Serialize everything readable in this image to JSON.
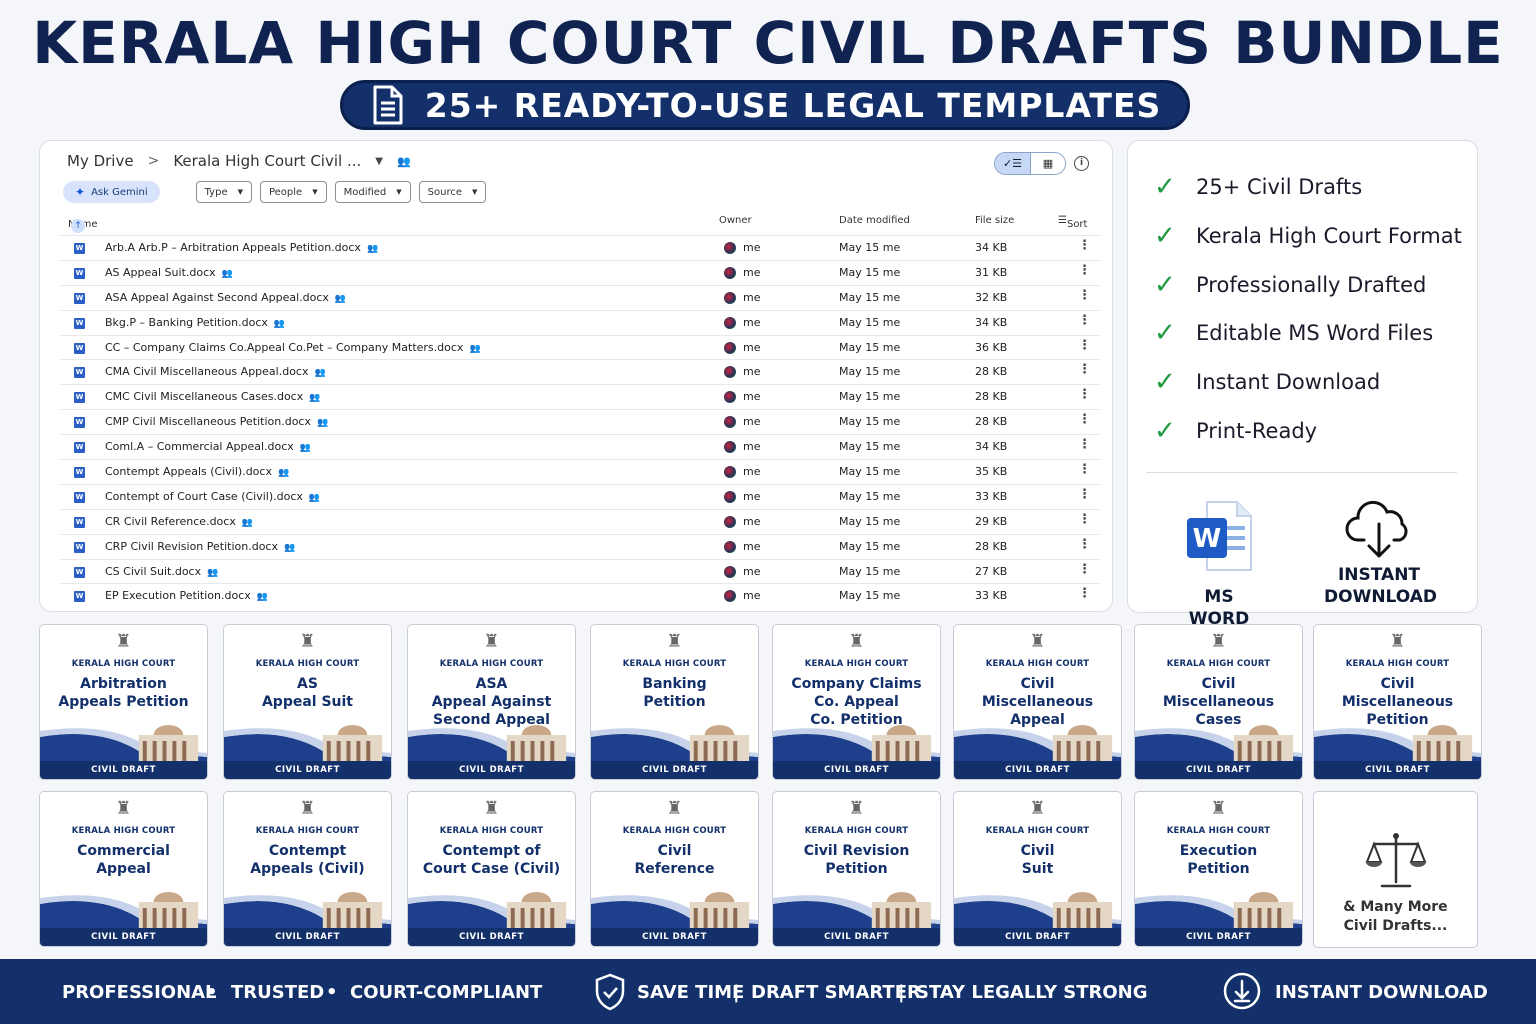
{
  "title": "KERALA HIGH COURT CIVIL DRAFTS BUNDLE",
  "subtitle": "25+ READY-TO-USE LEGAL TEMPLATES",
  "drive": {
    "crumb_root": "My Drive",
    "crumb_sep": ">",
    "crumb_current": "Kerala High Court Civil ...",
    "ask_gemini": "Ask Gemini",
    "filters": [
      "Type",
      "People",
      "Modified",
      "Source"
    ],
    "columns": {
      "name": "Name",
      "owner": "Owner",
      "date": "Date modified",
      "size": "File size",
      "sort": "Sort"
    },
    "files": [
      {
        "name": "Arb.A  Arb.P – Arbitration Appeals  Petition.docx",
        "owner": "me",
        "date": "May 15 me",
        "size": "34 KB"
      },
      {
        "name": "AS Appeal Suit.docx",
        "owner": "me",
        "date": "May 15 me",
        "size": "31 KB"
      },
      {
        "name": "ASA Appeal Against Second Appeal.docx",
        "owner": "me",
        "date": "May 15 me",
        "size": "32 KB"
      },
      {
        "name": "Bkg.P – Banking Petition.docx",
        "owner": "me",
        "date": "May 15 me",
        "size": "34 KB"
      },
      {
        "name": "CC – Company Claims  Co.Appeal  Co.Pet – Company Matters.docx",
        "owner": "me",
        "date": "May 15 me",
        "size": "36 KB"
      },
      {
        "name": "CMA Civil Miscellaneous Appeal.docx",
        "owner": "me",
        "date": "May 15 me",
        "size": "28 KB"
      },
      {
        "name": "CMC Civil Miscellaneous Cases.docx",
        "owner": "me",
        "date": "May 15 me",
        "size": "28 KB"
      },
      {
        "name": "CMP Civil Miscellaneous Petition.docx",
        "owner": "me",
        "date": "May 15 me",
        "size": "28 KB"
      },
      {
        "name": "Coml.A – Commercial Appeal.docx",
        "owner": "me",
        "date": "May 15 me",
        "size": "34 KB"
      },
      {
        "name": "Contempt Appeals (Civil).docx",
        "owner": "me",
        "date": "May 15 me",
        "size": "35 KB"
      },
      {
        "name": "Contempt of Court Case (Civil).docx",
        "owner": "me",
        "date": "May 15 me",
        "size": "33 KB"
      },
      {
        "name": "CR Civil Reference.docx",
        "owner": "me",
        "date": "May 15 me",
        "size": "29 KB"
      },
      {
        "name": "CRP Civil Revision Petition.docx",
        "owner": "me",
        "date": "May 15 me",
        "size": "28 KB"
      },
      {
        "name": "CS Civil Suit.docx",
        "owner": "me",
        "date": "May 15 me",
        "size": "27 KB"
      },
      {
        "name": "EP Execution Petition.docx",
        "owner": "me",
        "date": "May 15 me",
        "size": "33 KB"
      }
    ]
  },
  "features": {
    "items": [
      "25+ Civil Drafts",
      "Kerala High Court Format",
      "Professionally Drafted",
      "Editable MS Word Files",
      "Instant Download",
      "Print-Ready"
    ],
    "msword_label": "MS WORD",
    "download_label_1": "INSTANT",
    "download_label_2": "DOWNLOAD"
  },
  "cards": {
    "court": "KERALA HIGH COURT",
    "tag": "CIVIL DRAFT",
    "items": [
      [
        "Arbitration",
        "Appeals Petition"
      ],
      [
        "AS",
        "Appeal Suit"
      ],
      [
        "ASA",
        "Appeal Against",
        "Second Appeal"
      ],
      [
        "Banking",
        "Petition"
      ],
      [
        "Company Claims",
        "Co. Appeal",
        "Co. Petition"
      ],
      [
        "Civil",
        "Miscellaneous",
        "Appeal"
      ],
      [
        "Civil",
        "Miscellaneous",
        "Cases"
      ],
      [
        "Civil",
        "Miscellaneous",
        "Petition"
      ],
      [
        "Commercial",
        "Appeal"
      ],
      [
        "Contempt",
        "Appeals (Civil)"
      ],
      [
        "Contempt of",
        "Court Case (Civil)"
      ],
      [
        "Civil",
        "Reference"
      ],
      [
        "Civil Revision",
        "Petition"
      ],
      [
        "Civil",
        "Suit"
      ],
      [
        "Execution",
        "Petition"
      ]
    ],
    "more_1": "& Many More",
    "more_2": "Civil Drafts..."
  },
  "footer": {
    "professional": "PROFESSIONAL",
    "trusted": "TRUSTED",
    "compliant": "COURT-COMPLIANT",
    "bullet": "•",
    "save_time": "SAVE TIME",
    "draft_smarter": "DRAFT SMARTER",
    "stay_strong": "STAY LEGALLY STRONG",
    "pipe": "|",
    "instant": "INSTANT DOWNLOAD"
  }
}
